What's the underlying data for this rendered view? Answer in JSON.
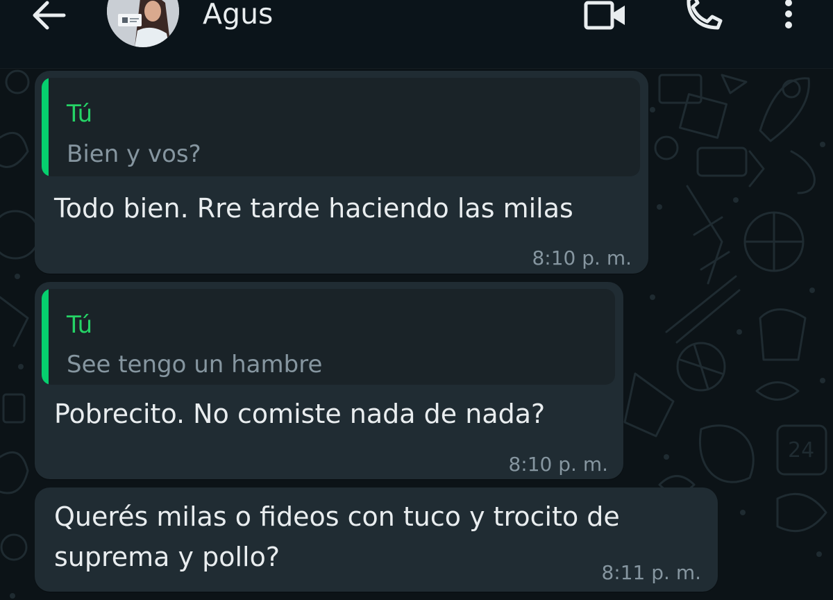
{
  "header": {
    "contact_name": "Agus",
    "icons": [
      "back-arrow-icon",
      "video-call-icon",
      "phone-icon",
      "more-vertical-icon"
    ]
  },
  "colors": {
    "background": "#0b141a",
    "bubble": "#202c33",
    "quote_accent": "#06cf6e",
    "quote_author": "#25d366",
    "text_primary": "#e9edef",
    "text_secondary": "#8696a0"
  },
  "messages": [
    {
      "quote": {
        "author": "Tú",
        "text": "Bien y vos?"
      },
      "text": "Todo bien. Rre tarde haciendo las milas",
      "time": "8:10 p. m."
    },
    {
      "quote": {
        "author": "Tú",
        "text": "See tengo un hambre"
      },
      "text": "Pobrecito. No comiste nada de nada?",
      "time": "8:10 p. m."
    },
    {
      "text_line1": "Querés milas o fideos con tuco y trocito de",
      "text_line2": "suprema y pollo?",
      "time": "8:11 p. m."
    }
  ]
}
